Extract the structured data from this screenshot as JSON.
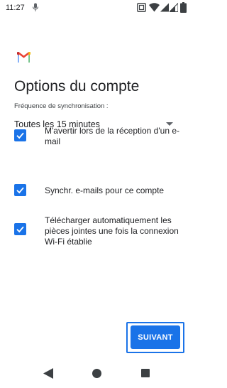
{
  "status_bar": {
    "time": "11:27",
    "icons": [
      "mic-icon",
      "nfc-icon",
      "wifi-icon",
      "signal-icon",
      "signal-icon",
      "battery-icon"
    ]
  },
  "app": {
    "logo": "gmail-logo",
    "title": "Options du compte"
  },
  "sync": {
    "label": "Fréquence de synchronisation :",
    "selected": "Toutes les 15 minutes"
  },
  "options": [
    {
      "label": "M'avertir lors de la réception d'un e-mail",
      "checked": true
    },
    {
      "label": "Synchr. e-mails pour ce compte",
      "checked": true
    },
    {
      "label": "Télécharger automatiquement les pièces jointes une fois la connexion Wi-Fi établie",
      "checked": true
    }
  ],
  "actions": {
    "next_label": "SUIVANT"
  },
  "colors": {
    "accent": "#1a73e8",
    "text": "#202124"
  },
  "nav": [
    "back-icon",
    "home-icon",
    "recents-icon"
  ]
}
